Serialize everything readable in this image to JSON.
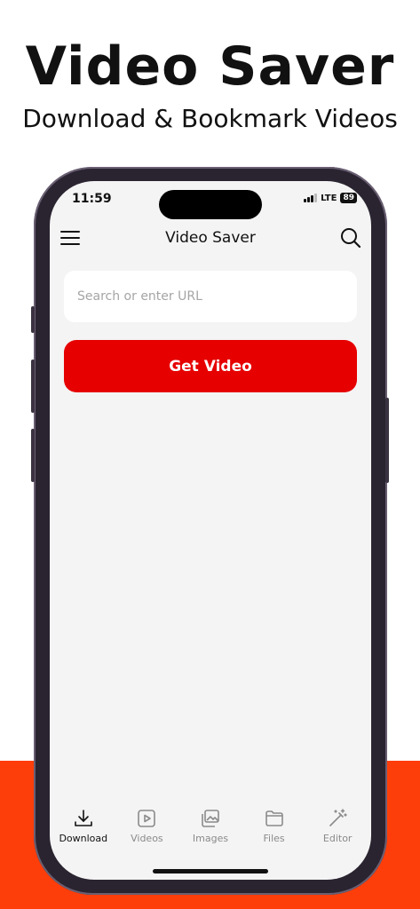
{
  "promo": {
    "headline": "Video Saver",
    "subheadline": "Download & Bookmark Videos",
    "accent_color": "#fe3e0a"
  },
  "status_bar": {
    "time": "11:59",
    "network": "LTE",
    "battery": "89"
  },
  "nav": {
    "title": "Video Saver",
    "menu_icon": "hamburger-menu-icon",
    "search_icon": "search-icon"
  },
  "search": {
    "placeholder": "Search or enter URL",
    "value": ""
  },
  "get_video_button": {
    "label": "Get Video",
    "color": "#e60000"
  },
  "tabs": [
    {
      "label": "Download",
      "icon": "download-icon",
      "active": true
    },
    {
      "label": "Videos",
      "icon": "video-play-icon",
      "active": false
    },
    {
      "label": "Images",
      "icon": "images-icon",
      "active": false
    },
    {
      "label": "Files",
      "icon": "folder-icon",
      "active": false
    },
    {
      "label": "Editor",
      "icon": "magic-wand-icon",
      "active": false
    }
  ]
}
